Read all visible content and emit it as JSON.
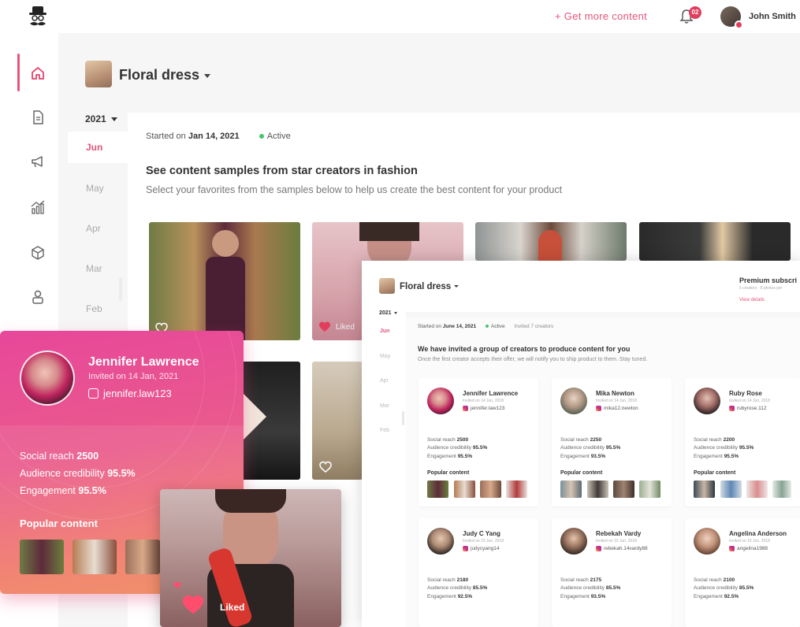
{
  "header": {
    "get_more": "+ Get more content",
    "notification_count": "02",
    "user_name": "John Smith"
  },
  "rail": {
    "icons": [
      "home-icon",
      "document-icon",
      "megaphone-icon",
      "chart-icon",
      "cube-icon",
      "user-icon"
    ]
  },
  "campaign": {
    "title": "Floral dress",
    "year": "2021",
    "months": [
      "Jun",
      "May",
      "Apr",
      "Mar",
      "Feb"
    ],
    "started_prefix": "Started on",
    "started_date": "Jan 14, 2021",
    "status": "Active",
    "section_title": "See content samples from star creators in fashion",
    "section_subtitle": "Select your favorites from the samples below to help us create the best content for your product",
    "liked_label": "Liked"
  },
  "highlight": {
    "name": "Jennifer Lawrence",
    "invited": "Invited on 14 Jan, 2021",
    "handle": "jennifer.law123",
    "stats": [
      {
        "label": "Social reach",
        "value": "2500"
      },
      {
        "label": "Audience credibility",
        "value": "95.5%"
      },
      {
        "label": "Engagement",
        "value": "95.5%"
      }
    ],
    "popular_label": "Popular content",
    "liked_label": "Liked"
  },
  "overlay": {
    "title": "Floral dress",
    "premium": "Premium subscri",
    "premium_sub": "5 creators · 8 photos per",
    "view_details": "View details",
    "year": "2021",
    "months": [
      "Jun",
      "May",
      "Apr",
      "Mar",
      "Feb"
    ],
    "started_prefix": "Started on",
    "started_date": "June 14, 2021",
    "status": "Active",
    "invited": "Invited 7 creators",
    "heading": "We have invited a group of creators to produce content for you",
    "subheading": "Once the first creator accepts their offer, we will notify you to ship product to them. Stay tuned.",
    "popular_label": "Popular content",
    "creators": [
      {
        "name": "Jennifer Lawrence",
        "invited": "Invited on 14 Jun, 2018",
        "handle": "jennifer.law123",
        "reach": "2500",
        "credibility": "95.5%",
        "engagement": "95.5%"
      },
      {
        "name": "Mika Newton",
        "invited": "Invited on 14 Jun, 2018",
        "handle": "mika12.newton",
        "reach": "2250",
        "credibility": "95.5%",
        "engagement": "93.5%"
      },
      {
        "name": "Ruby Rose",
        "invited": "Invited on 14 Jun, 2018",
        "handle": "rubyrose.112",
        "reach": "2200",
        "credibility": "95.5%",
        "engagement": "95.5%"
      },
      {
        "name": "Judy C Yang",
        "invited": "Invited on 15 Jun, 2018",
        "handle": "judycyang14",
        "reach": "2180",
        "credibility": "85.5%",
        "engagement": "92.5%"
      },
      {
        "name": "Rebekah Vardy",
        "invited": "Invited on 15 Jun, 2018",
        "handle": "rebekah.14vardy88",
        "reach": "2175",
        "credibility": "85.5%",
        "engagement": "93.5%"
      },
      {
        "name": "Angelina Anderson",
        "invited": "Invited on 15 Jun, 2018",
        "handle": "angelina1988",
        "reach": "2100",
        "credibility": "85.5%",
        "engagement": "92.5%"
      }
    ],
    "stat_labels": {
      "reach": "Social reach",
      "credibility": "Audience credibility",
      "engagement": "Engagement"
    }
  },
  "colors": {
    "accent": "#e5547a",
    "active_status": "#46c46f",
    "badge": "#e23d5c"
  }
}
